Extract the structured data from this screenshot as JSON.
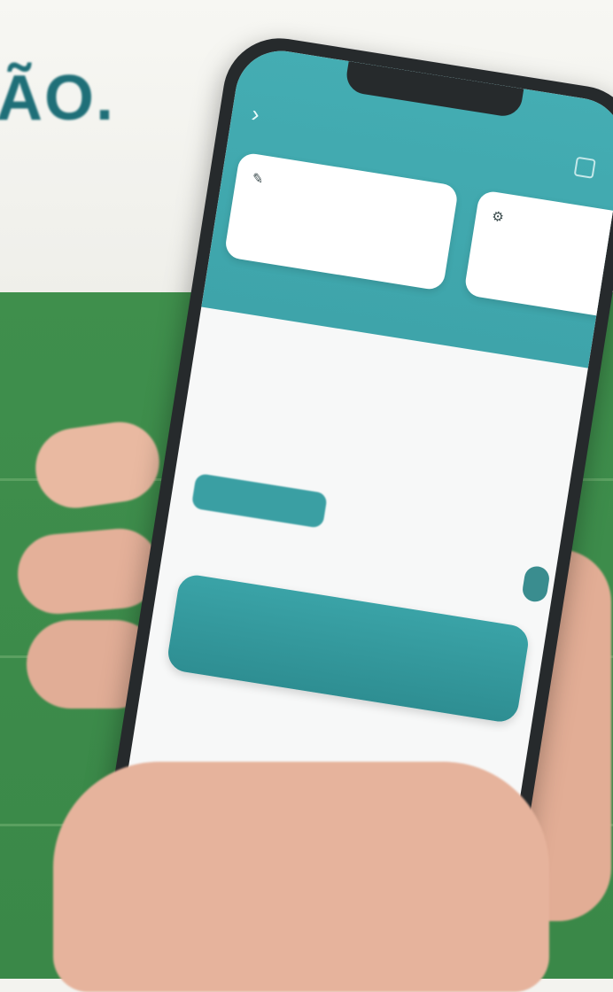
{
  "background": {
    "wall_text": "ÃO.",
    "colors": {
      "wall": "#f3f3ef",
      "banner": "#3d8c4b",
      "wall_text": "#1f6f78"
    }
  },
  "app": {
    "header": {
      "title": "",
      "back_icon": "chevron-right-icon",
      "action_icon": "square-icon"
    },
    "cards": [
      {
        "icon": "pencil-icon",
        "text": ""
      },
      {
        "icon": "gear-icon",
        "text": ""
      }
    ],
    "section": {
      "title": "",
      "link": ""
    },
    "item": {
      "title": "",
      "subtitle": "",
      "amount": "",
      "meta": "",
      "button_label": "",
      "meta2": ""
    },
    "cta": {
      "label": ""
    },
    "footer_note": "",
    "bottom_nav": [
      {
        "icon": "play-icon",
        "label": ""
      },
      {
        "icon": "close-icon",
        "label": ""
      },
      {
        "icon": "list-icon",
        "label": ""
      },
      {
        "icon": "grid-icon",
        "label": ""
      },
      {
        "icon": "user-icon",
        "label": ""
      }
    ],
    "colors": {
      "primary": "#3ea4aa",
      "button": "#3a9fa3",
      "surface": "#f7f8f8"
    }
  }
}
